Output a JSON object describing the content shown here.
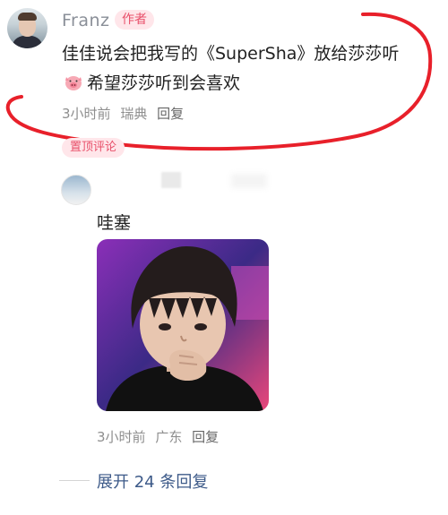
{
  "comment": {
    "author": "Franz",
    "author_badge": "作者",
    "text_before_emoji": "佳佳说会把我写的《SuperSha》放给莎莎听",
    "emoji": "pig-face-emoji",
    "text_after_emoji": "希望莎莎听到会喜欢",
    "time": "3小时前",
    "location": "瑞典",
    "reply_label": "回复",
    "pinned_label": "置顶评论"
  },
  "reply": {
    "text": "哇塞",
    "image": "photo of a person with bangs resting chin on hand, purple background",
    "time": "3小时前",
    "location": "广东",
    "reply_label": "回复"
  },
  "expand": {
    "label": "展开 24 条回复"
  },
  "colors": {
    "badge_bg": "#ffe6ea",
    "badge_text": "#e8506a",
    "annotation_red": "#e8202a",
    "link_blue": "#3d5a89"
  }
}
